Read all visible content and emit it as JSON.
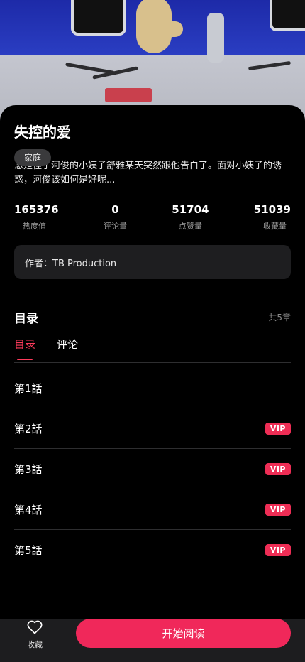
{
  "book": {
    "title": "失控的爱",
    "tag": "家庭",
    "description": "恩是怪了河俊的小姨子舒雅某天突然跟他告白了。面对小姨子的诱惑，河俊该如何是好呢..."
  },
  "stats": [
    {
      "value": "165376",
      "label": "热度值"
    },
    {
      "value": "0",
      "label": "评论量"
    },
    {
      "value": "51704",
      "label": "点赞量"
    },
    {
      "value": "51039",
      "label": "收藏量"
    }
  ],
  "author": {
    "text": "作者：TB Production"
  },
  "toc": {
    "title": "目录",
    "count": "共5章",
    "tabs": [
      {
        "label": "目录",
        "active": true
      },
      {
        "label": "评论",
        "active": false
      }
    ],
    "chapters": [
      {
        "name": "第1話",
        "badge": ""
      },
      {
        "name": "第2話",
        "badge": "VIP"
      },
      {
        "name": "第3話",
        "badge": "VIP"
      },
      {
        "name": "第4話",
        "badge": "VIP"
      },
      {
        "name": "第5話",
        "badge": "VIP"
      }
    ]
  },
  "bottom_bar": {
    "favorite_label": "收藏",
    "favorite_icon": "heart-icon",
    "read_button": "开始阅读"
  },
  "colors": {
    "accent": "#f0285a",
    "vip_badge": "#ee2d55",
    "background": "#000000",
    "card": "#1e1e20"
  }
}
